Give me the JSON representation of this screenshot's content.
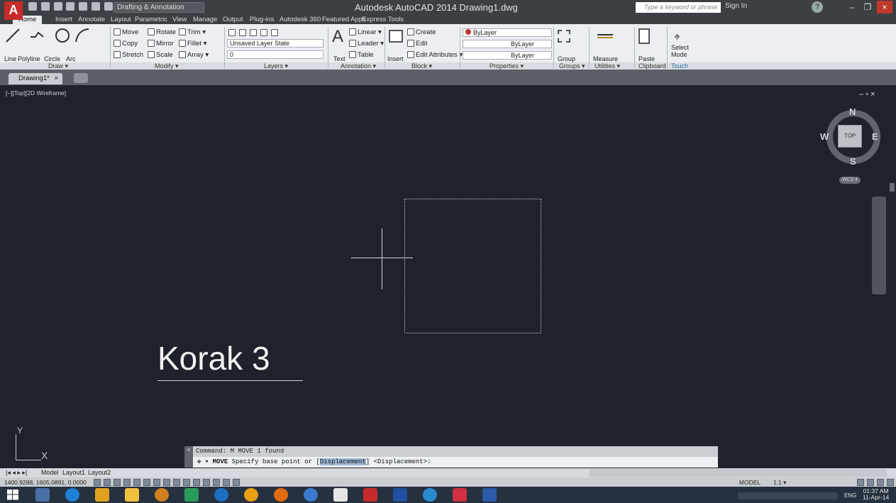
{
  "titlebar": {
    "app_letter": "A",
    "workspace": "Drafting & Annotation",
    "title": "Autodesk AutoCAD 2014   Drawing1.dwg",
    "search_placeholder": "Type a keyword or phrase",
    "signin": "Sign In",
    "help": "?"
  },
  "ribbon_tabs": [
    "Home",
    "Insert",
    "Annotate",
    "Layout",
    "Parametric",
    "View",
    "Manage",
    "Output",
    "Plug-ins",
    "Autodesk 360",
    "Featured Apps",
    "Express Tools"
  ],
  "ribbon": {
    "draw": {
      "title": "Draw ▾",
      "line": "Line",
      "polyline": "Polyline",
      "circle": "Circle",
      "arc": "Arc"
    },
    "modify": {
      "title": "Modify ▾",
      "move": "Move",
      "rotate": "Rotate",
      "trim": "Trim ▾",
      "copy": "Copy",
      "mirror": "Mirror",
      "fillet": "Fillet ▾",
      "stretch": "Stretch",
      "scale": "Scale",
      "array": "Array ▾"
    },
    "layers": {
      "title": "Layers ▾",
      "layer_state": "Unsaved Layer State",
      "current_layer": "0"
    },
    "annotation": {
      "title": "Annotation ▾",
      "text": "Text",
      "linear": "Linear ▾",
      "leader": "Leader ▾",
      "table": "Table"
    },
    "block": {
      "title": "Block ▾",
      "insert": "Insert",
      "create": "Create",
      "edit": "Edit",
      "edit_attributes": "Edit Attributes ▾"
    },
    "properties": {
      "title": "Properties ▾",
      "color": "ByLayer",
      "linetype": "ByLayer",
      "lineweight": "ByLayer"
    },
    "groups": {
      "title": "Groups ▾",
      "group": "Group"
    },
    "utilities": {
      "title": "Utilities ▾",
      "measure": "Measure"
    },
    "clipboard": {
      "title": "Clipboard",
      "paste": "Paste"
    },
    "touch": {
      "title": "Touch",
      "select_mode": "Select\nMode"
    }
  },
  "file_tabs": {
    "drawing": "Drawing1*",
    "close": "×"
  },
  "viewport": {
    "label": "[–][Top][2D Wireframe]",
    "controls": "– ▫ ×",
    "caption": "Korak 3"
  },
  "viewcube": {
    "n": "N",
    "s": "S",
    "e": "E",
    "w": "W",
    "face": "TOP",
    "wcs": "WCS ▾"
  },
  "ucs": {
    "x": "X",
    "y": "Y"
  },
  "command": {
    "history": "Command: M MOVE 1 found",
    "prompt_cmd": "MOVE",
    "prompt_text": " Specify base point or [",
    "keyword": "Displacement",
    "prompt_tail": "] <Displacement>:"
  },
  "layout_tabs": [
    "Model",
    "Layout1",
    "Layout2"
  ],
  "status": {
    "coords": "1400.9288, 1605.0891, 0.0000",
    "model": "MODEL",
    "scale": "1:1 ▾"
  },
  "taskbar": {
    "lang": "ENG",
    "time": "01:37 AM",
    "date": "11-Apr-14"
  },
  "colors": {
    "canvas": "#1e222a",
    "accent": "#c72a2a",
    "ribbon": "#eceef1"
  }
}
